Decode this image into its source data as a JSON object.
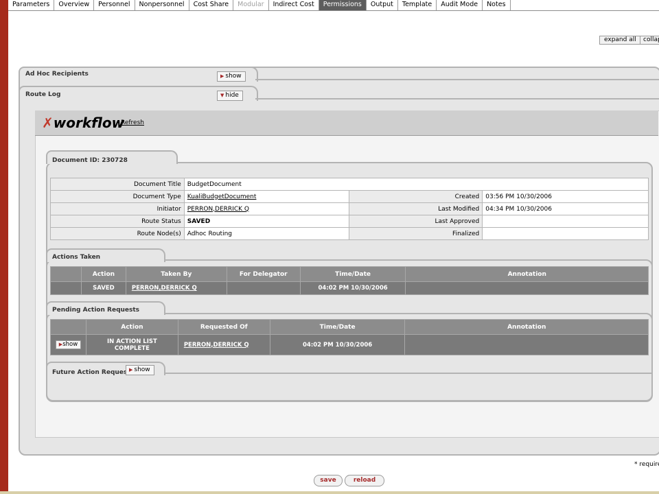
{
  "tabs": [
    {
      "label": "Parameters",
      "state": "normal"
    },
    {
      "label": "Overview",
      "state": "normal"
    },
    {
      "label": "Personnel",
      "state": "normal"
    },
    {
      "label": "Nonpersonnel",
      "state": "normal"
    },
    {
      "label": "Cost Share",
      "state": "normal"
    },
    {
      "label": "Modular",
      "state": "disabled"
    },
    {
      "label": "Indirect Cost",
      "state": "normal"
    },
    {
      "label": "Permissions",
      "state": "active"
    },
    {
      "label": "Output",
      "state": "normal"
    },
    {
      "label": "Template",
      "state": "normal"
    },
    {
      "label": "Audit Mode",
      "state": "normal"
    },
    {
      "label": "Notes",
      "state": "normal"
    }
  ],
  "expand_all": "expand all",
  "collapse_all": "collap",
  "adhoc": {
    "title": "Ad Hoc Recipients",
    "toggle": "show"
  },
  "routelog": {
    "title": "Route Log",
    "toggle": "hide"
  },
  "workflow": {
    "logo": "workflow",
    "refresh": "Refresh"
  },
  "document": {
    "id_label": "Document ID: 230728",
    "rows": {
      "title_label": "Document Title",
      "title_value": "BudgetDocument",
      "type_label": "Document Type",
      "type_value": "KualiBudgetDocument",
      "initiator_label": "Initiator",
      "initiator_value": "PERRON,DERRICK Q",
      "status_label": "Route Status",
      "status_value": "SAVED",
      "node_label": "Route Node(s)",
      "node_value": "Adhoc Routing",
      "created_label": "Created",
      "created_value": "03:56 PM 10/30/2006",
      "modified_label": "Last Modified",
      "modified_value": "04:34 PM 10/30/2006",
      "approved_label": "Last Approved",
      "approved_value": "",
      "finalized_label": "Finalized",
      "finalized_value": ""
    }
  },
  "actions_taken": {
    "title": "Actions Taken",
    "headers": [
      "Action",
      "Taken By",
      "For Delegator",
      "Time/Date",
      "Annotation"
    ],
    "row": {
      "action": "SAVED",
      "taken_by": "PERRON,DERRICK Q",
      "delegator": "",
      "time": "04:02 PM 10/30/2006",
      "annotation": ""
    }
  },
  "pending": {
    "title": "Pending Action Requests",
    "headers": [
      "Action",
      "Requested Of",
      "Time/Date",
      "Annotation"
    ],
    "row": {
      "toggle": "show",
      "action_line1": "IN ACTION LIST",
      "action_line2": "COMPLETE",
      "requested_of": "PERRON,DERRICK Q",
      "time": "04:02 PM 10/30/2006",
      "annotation": ""
    }
  },
  "future": {
    "title": "Future Action Requests",
    "toggle": "show"
  },
  "required_note": "* require",
  "buttons": {
    "save": "save",
    "reload": "reload"
  }
}
